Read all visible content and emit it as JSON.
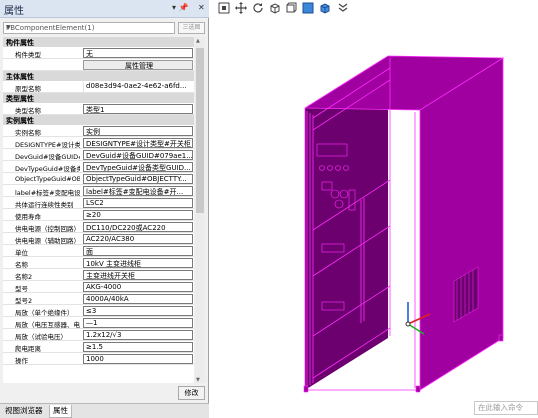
{
  "panel": {
    "title": "属性",
    "controls": {
      "pin": "▾ 📌",
      "close": "✕"
    },
    "element_selector": {
      "value": "PBComponentElement(1)",
      "select_label": "三选图"
    }
  },
  "categories": [
    {
      "name": "构件属性",
      "toggle": "−",
      "rows": [
        {
          "name": "构件类型",
          "value": "无",
          "kind": "combo"
        },
        {
          "name": "",
          "value": "属性管理",
          "kind": "button"
        }
      ]
    },
    {
      "name": "主体属性",
      "toggle": "−",
      "rows": [
        {
          "name": "原型名称",
          "value": "d08e3d94-0ae2-4e62-a6fd...",
          "kind": "text"
        }
      ]
    },
    {
      "name": "类型属性",
      "toggle": "−",
      "rows": [
        {
          "name": "类型名称",
          "value": "类型1",
          "kind": "box"
        }
      ]
    },
    {
      "name": "实例属性",
      "toggle": "−",
      "rows": [
        {
          "name": "实例名称",
          "value": "实例",
          "kind": "box"
        },
        {
          "name": "DESIGNTYPE#设计类型#开关柜",
          "value": "DESIGNTYPE#设计类型#开关柜",
          "kind": "box"
        },
        {
          "name": "DevGuid#设备GUID#079...",
          "value": "DevGuid#设备GUID#079ae1...",
          "kind": "box"
        },
        {
          "name": "DevTypeGuid#设备类型GUID",
          "value": "DevTypeGuid#设备类型GUID...",
          "kind": "box"
        },
        {
          "name": "ObjectTypeGuid#OBJECTTYPE",
          "value": "ObjectTypeGuid#OBJECTTY...",
          "kind": "box"
        },
        {
          "name": "label#标签#变配电设备",
          "value": "label#标签#变配电设备#开...",
          "kind": "box"
        },
        {
          "name": "共体运行连续性类别",
          "value": "LSC2",
          "kind": "box"
        },
        {
          "name": "使用寿命",
          "value": "≥20",
          "kind": "box"
        },
        {
          "name": "供电电源（控制回路）",
          "value": "DC110/DC220或AC220",
          "kind": "box"
        },
        {
          "name": "供电电源（辅助回路）",
          "value": "AC220/AC380",
          "kind": "box"
        },
        {
          "name": "单位",
          "value": "面",
          "kind": "box"
        },
        {
          "name": "名称",
          "value": "10kV 主变进线柜",
          "kind": "box"
        },
        {
          "name": "名称2",
          "value": "主变进线开关柜",
          "kind": "box"
        },
        {
          "name": "型号",
          "value": "AKG-4000",
          "kind": "box"
        },
        {
          "name": "型号2",
          "value": "4000A/40kA",
          "kind": "box"
        },
        {
          "name": "局放（单个绝缘件）",
          "value": "≤3",
          "kind": "box"
        },
        {
          "name": "局放（电压互感器、电流互感器）",
          "value": "—1",
          "kind": "box"
        },
        {
          "name": "局放（试验电压）",
          "value": "1.2x12/√3",
          "kind": "box"
        },
        {
          "name": "爬电距离",
          "value": "≥1.5",
          "kind": "box"
        },
        {
          "name": "操作",
          "value": "1000",
          "kind": "box"
        }
      ]
    }
  ],
  "buttons": {
    "modify": "修改"
  },
  "tabs": [
    {
      "label": "视图浏览器",
      "active": false
    },
    {
      "label": "属性",
      "active": true
    }
  ],
  "toolbar": [
    "fit-view-icon",
    "pan-icon",
    "rotate-icon",
    "box-icon",
    "front-view-icon",
    "iso-view-icon",
    "solid-view-icon",
    "more-icon"
  ],
  "command_input": {
    "placeholder": "在此输入命令"
  },
  "model": {
    "color": "#a000a0",
    "dark": "#6d006f",
    "edge": "#ff2dff"
  }
}
